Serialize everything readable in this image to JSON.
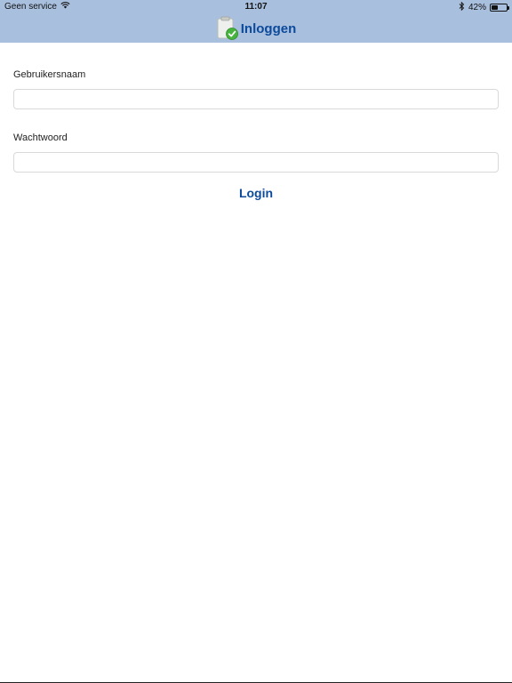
{
  "status_bar": {
    "carrier": "Geen service",
    "time": "11:07",
    "battery_percent": "42%",
    "battery_level": 0.42,
    "icons": [
      "wifi-icon",
      "bluetooth-icon",
      "battery-icon"
    ]
  },
  "nav": {
    "title": "Inloggen",
    "icon": "clipboard-check-icon"
  },
  "form": {
    "username_label": "Gebruikersnaam",
    "username_value": "",
    "password_label": "Wachtwoord",
    "password_value": "",
    "login_label": "Login"
  },
  "colors": {
    "header_bg": "#a9bfde",
    "accent": "#0c4a9b"
  }
}
